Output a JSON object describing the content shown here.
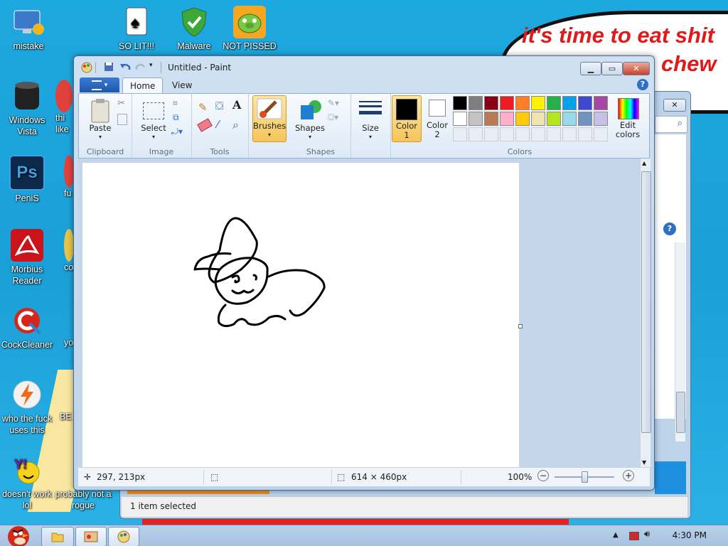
{
  "desktop": {
    "icons": [
      {
        "label": "mistake"
      },
      {
        "label": "SO LIT!!!"
      },
      {
        "label": "Malware"
      },
      {
        "label": "NOT PISSED"
      },
      {
        "label": "Windows Vista"
      },
      {
        "label": "PeniS"
      },
      {
        "label": "Morbius Reader"
      },
      {
        "label": "CockCleaner"
      },
      {
        "label": "who the fuck uses this"
      },
      {
        "label": "doesn't work lol"
      },
      {
        "label": "probably not a rogue"
      }
    ],
    "partial_labels": [
      "thi",
      "like",
      "fu",
      "co",
      "yo",
      "BE"
    ],
    "bubble_lines": [
      "it's time to eat shit",
      "chew"
    ]
  },
  "paint": {
    "title": "Untitled - Paint",
    "tabs": {
      "file": "",
      "home": "Home",
      "view": "View"
    },
    "groups": {
      "clipboard": "Clipboard",
      "image": "Image",
      "tools": "Tools",
      "shapes": "Shapes",
      "colors": "Colors"
    },
    "buttons": {
      "paste": "Paste",
      "select": "Select",
      "brushes": "Brushes",
      "shapes": "Shapes",
      "size": "Size",
      "color1": "Color 1",
      "color2": "Color 2",
      "edit_colors": "Edit colors"
    },
    "palette_row1": [
      "#000000",
      "#7f7f7f",
      "#880015",
      "#ed1c24",
      "#ff7f27",
      "#fff200",
      "#22b14c",
      "#00a2e8",
      "#3f48cc",
      "#a349a4"
    ],
    "palette_row2": [
      "#ffffff",
      "#c3c3c3",
      "#b97a57",
      "#ffaec9",
      "#ffc90e",
      "#efe4b0",
      "#b5e61d",
      "#99d9ea",
      "#7092be",
      "#c8bfe7"
    ],
    "color1_value": "#000000",
    "color2_value": "#ffffff",
    "status": {
      "cursor_pos": "297, 213px",
      "canvas_size": "614 × 460px",
      "zoom": "100%"
    }
  },
  "explorer": {
    "status": "1 item selected"
  },
  "taskbar": {
    "clock": "4:30 PM"
  }
}
